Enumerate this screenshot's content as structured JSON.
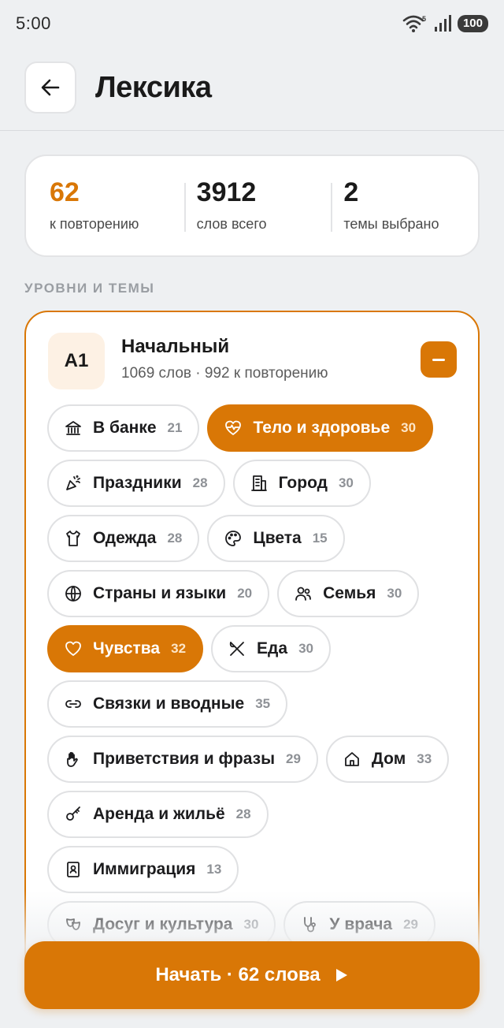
{
  "status_bar": {
    "time": "5:00",
    "battery": "100",
    "wifi_badge": "5"
  },
  "header": {
    "title": "Лексика",
    "back_icon": "arrow-left-icon"
  },
  "stats": [
    {
      "value": "62",
      "label": "к повторению",
      "accent": true
    },
    {
      "value": "3912",
      "label": "слов всего",
      "accent": false
    },
    {
      "value": "2",
      "label": "темы выбрано",
      "accent": false
    }
  ],
  "section_label": "УРОВНИ И ТЕМЫ",
  "level": {
    "code": "A1",
    "name": "Начальный",
    "subtitle": "1069 слов · 992 к повторению",
    "collapse_icon": "minus-icon",
    "topic_rows": [
      [
        {
          "label": "В банке",
          "count": "21",
          "icon": "bank",
          "selected": false
        },
        {
          "label": "Тело и здоровье",
          "count": "30",
          "icon": "heart-pulse",
          "selected": true
        }
      ],
      [
        {
          "label": "Праздники",
          "count": "28",
          "icon": "party",
          "selected": false
        },
        {
          "label": "Город",
          "count": "30",
          "icon": "building",
          "selected": false
        }
      ],
      [
        {
          "label": "Одежда",
          "count": "28",
          "icon": "shirt",
          "selected": false
        },
        {
          "label": "Цвета",
          "count": "15",
          "icon": "palette",
          "selected": false
        }
      ],
      [
        {
          "label": "Страны и языки",
          "count": "20",
          "icon": "globe",
          "selected": false
        },
        {
          "label": "Семья",
          "count": "30",
          "icon": "users",
          "selected": false
        }
      ],
      [
        {
          "label": "Чувства",
          "count": "32",
          "icon": "heart",
          "selected": true
        },
        {
          "label": "Еда",
          "count": "30",
          "icon": "utensils",
          "selected": false
        }
      ],
      [
        {
          "label": "Связки и вводные",
          "count": "35",
          "icon": "link",
          "selected": false
        }
      ],
      [
        {
          "label": "Приветствия и фразы",
          "count": "29",
          "icon": "hand",
          "selected": false
        },
        {
          "label": "Дом",
          "count": "33",
          "icon": "home",
          "selected": false
        }
      ],
      [
        {
          "label": "Аренда и жильё",
          "count": "28",
          "icon": "key",
          "selected": false
        }
      ],
      [
        {
          "label": "Иммиграция",
          "count": "13",
          "icon": "passport",
          "selected": false
        }
      ],
      [
        {
          "label": "Досуг и культура",
          "count": "30",
          "icon": "masks",
          "selected": false
        },
        {
          "label": "У врача",
          "count": "29",
          "icon": "stethoscope",
          "selected": false
        }
      ]
    ]
  },
  "start_button": {
    "label": "Начать · 62 слова",
    "icon": "play-icon"
  },
  "colors": {
    "accent": "#d97706",
    "background": "#eef0f2"
  }
}
